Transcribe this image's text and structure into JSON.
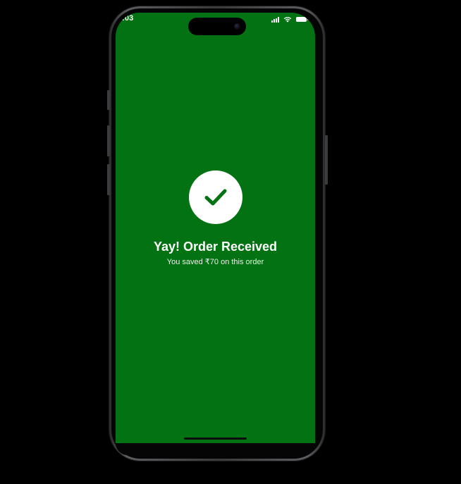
{
  "status_bar": {
    "time": ":03",
    "icons": [
      "signal-icon",
      "wifi-icon",
      "battery-icon"
    ]
  },
  "confirmation": {
    "icon": "checkmark-icon",
    "title": "Yay! Order Received",
    "subtitle": "You saved ₹70 on this order"
  },
  "colors": {
    "screen_background": "#037212",
    "circle": "#ffffff",
    "checkmark": "#037212",
    "page_background": "#000000"
  }
}
